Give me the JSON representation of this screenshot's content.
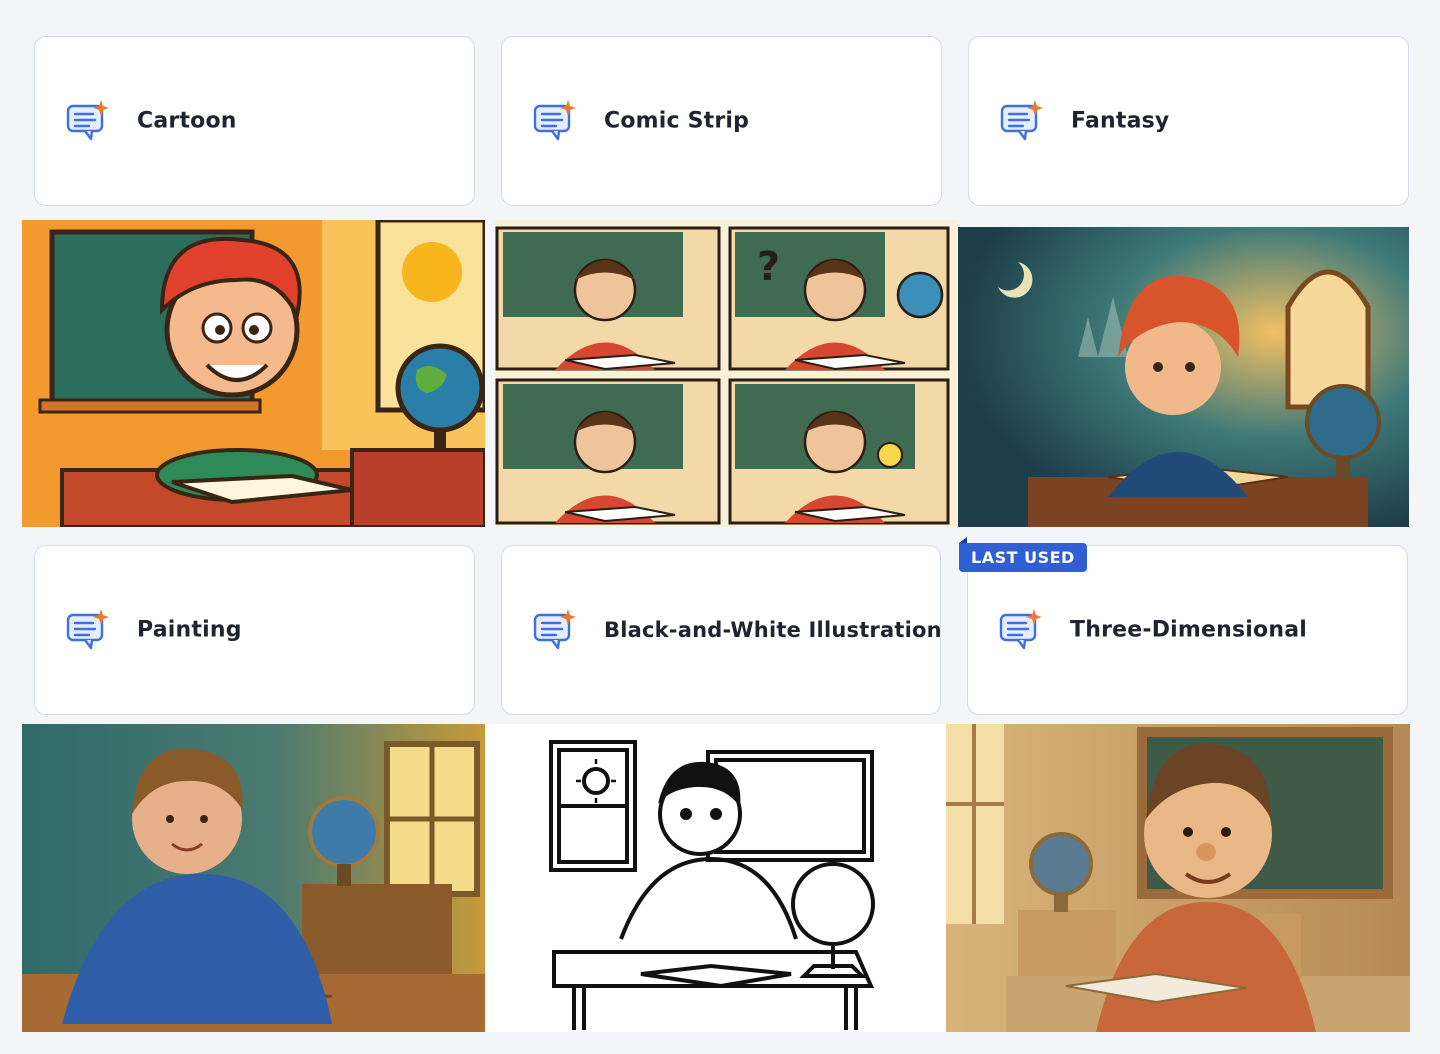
{
  "styles": [
    {
      "id": "cartoon",
      "label": "Cartoon",
      "icon": "chat-sparkle-icon"
    },
    {
      "id": "comic-strip",
      "label": "Comic Strip",
      "icon": "chat-sparkle-icon"
    },
    {
      "id": "fantasy",
      "label": "Fantasy",
      "icon": "chat-sparkle-icon"
    },
    {
      "id": "painting",
      "label": "Painting",
      "icon": "chat-sparkle-icon"
    },
    {
      "id": "bw-illustration",
      "label": "Black-and-White Illustration",
      "icon": "chat-sparkle-icon"
    },
    {
      "id": "three-dimensional",
      "label": "Three-Dimensional",
      "icon": "chat-sparkle-icon",
      "badge": "LAST USED"
    }
  ],
  "colors": {
    "accent": "#2f5fd3",
    "sparkle": "#f07a2b",
    "icon_outline": "#3f6fe0",
    "card_border": "#d6dae2",
    "background": "#f3f5f9"
  }
}
